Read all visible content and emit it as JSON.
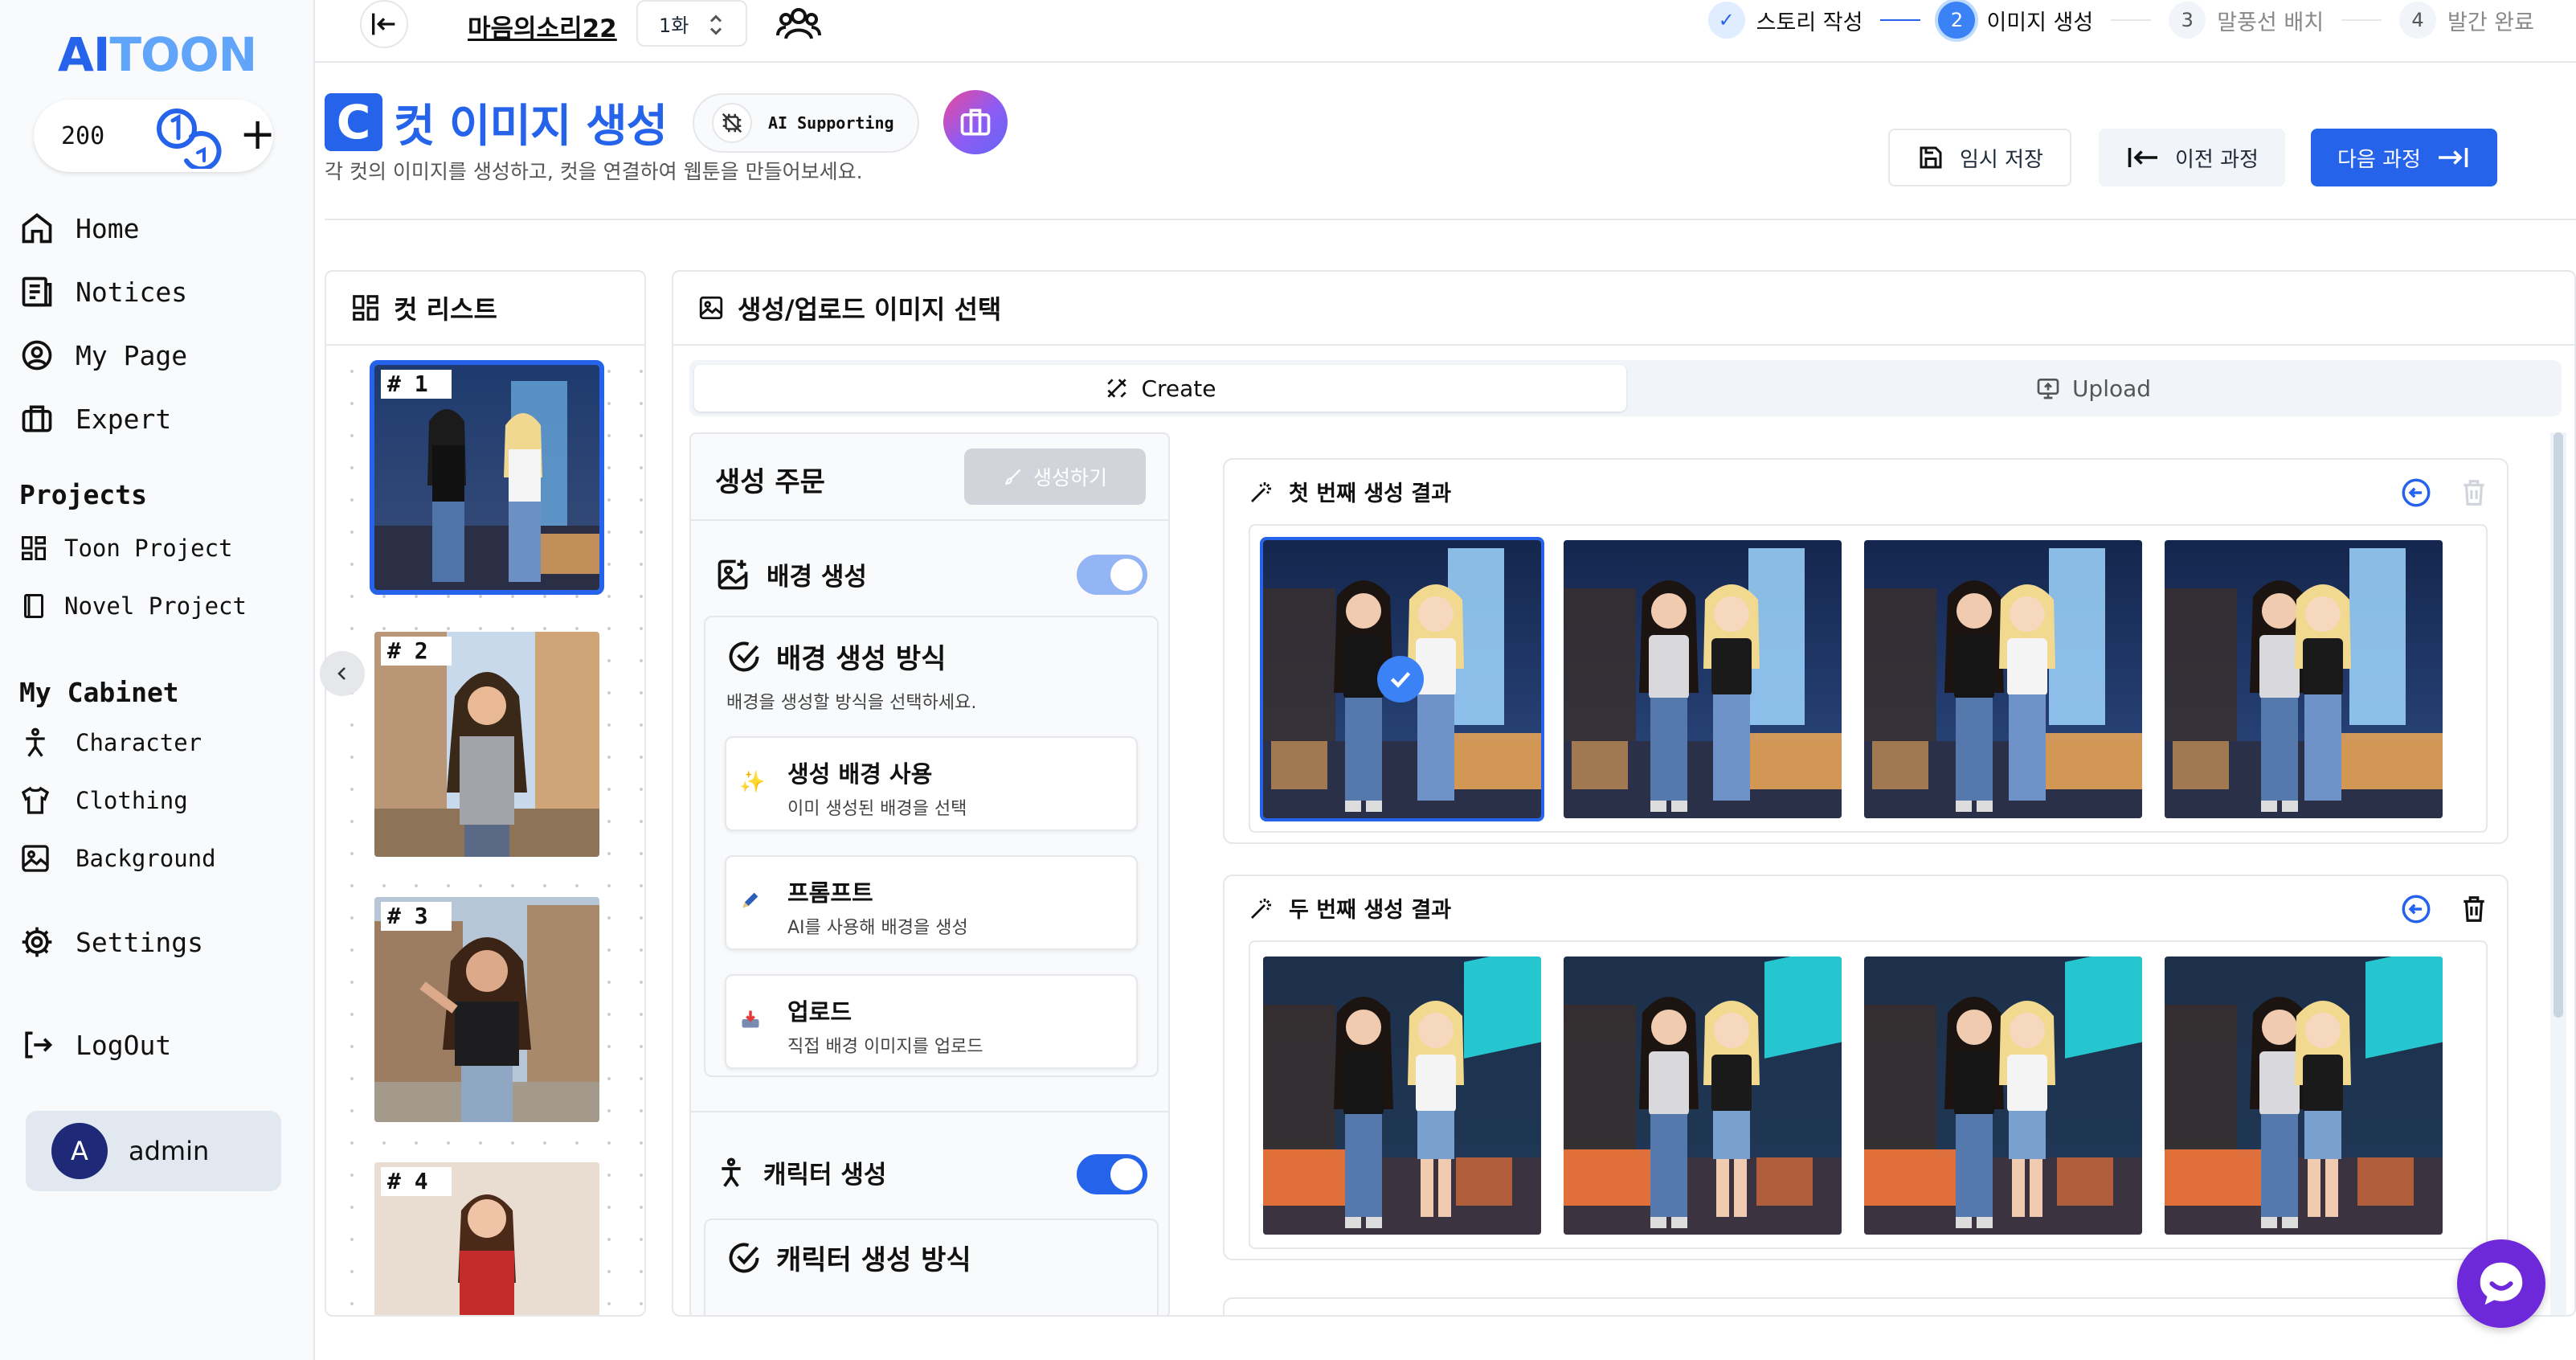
{
  "sidebar": {
    "logo_ai": "AI",
    "logo_toon": "TOON",
    "credits": "200",
    "nav_main": [
      {
        "label": "Home",
        "icon": "home-icon"
      },
      {
        "label": "Notices",
        "icon": "notices-icon"
      },
      {
        "label": "My Page",
        "icon": "user-circle-icon"
      },
      {
        "label": "Expert",
        "icon": "briefcase-icon"
      }
    ],
    "projects_heading": "Projects",
    "projects": [
      {
        "label": "Toon Project",
        "icon": "toon-icon"
      },
      {
        "label": "Novel Project",
        "icon": "book-icon"
      }
    ],
    "cabinet_heading": "My Cabinet",
    "cabinet": [
      {
        "label": "Character",
        "icon": "person-icon"
      },
      {
        "label": "Clothing",
        "icon": "shirt-icon"
      },
      {
        "label": "Background",
        "icon": "image-icon"
      }
    ],
    "settings": "Settings",
    "logout": "LogOut",
    "user": {
      "initial": "A",
      "name": "admin"
    }
  },
  "topbar": {
    "project_title": "마음의소리22",
    "episode": "1화",
    "steps": [
      {
        "label": "스토리 작성",
        "marker": "✓",
        "state": "done"
      },
      {
        "label": "이미지 생성",
        "marker": "2",
        "state": "active"
      },
      {
        "label": "말풍선 배치",
        "marker": "3",
        "state": "todo"
      },
      {
        "label": "발간 완료",
        "marker": "4",
        "state": "todo"
      }
    ]
  },
  "page": {
    "badge": "C",
    "title": "컷 이미지 생성",
    "ai_pill": "AI Supporting",
    "subtitle": "각 컷의 이미지를 생성하고, 컷을 연결하여 웹툰을 만들어보세요.",
    "btn_save": "임시 저장",
    "btn_prev": "이전 과정",
    "btn_next": "다음 과정"
  },
  "cutlist": {
    "title": "컷 리스트",
    "cuts": [
      "# 1",
      "# 2",
      "# 3",
      "# 4"
    ],
    "selected_index": 0
  },
  "main": {
    "title": "생성/업로드 이미지 선택",
    "tabs": [
      {
        "label": "Create",
        "active": true
      },
      {
        "label": "Upload",
        "active": false
      }
    ],
    "order": {
      "title": "생성 주문",
      "generate_btn": "생성하기",
      "bg_section": "배경 생성",
      "bg_toggle_on": true,
      "method_title": "배경 생성 방식",
      "method_sub": "배경을 생성할 방식을 선택하세요.",
      "options": [
        {
          "title": "생성 배경 사용",
          "sub": "이미 생성된 배경을 선택",
          "icon": "sparkle-icon"
        },
        {
          "title": "프롬프트",
          "sub": "AI를 사용해 배경을 생성",
          "icon": "pencil-icon"
        },
        {
          "title": "업로드",
          "sub": "직접 배경 이미지를 업로드",
          "icon": "inbox-icon"
        }
      ],
      "char_section": "캐릭터 생성",
      "char_toggle_on": true,
      "char_method_title": "캐릭터 생성 방식"
    },
    "results": [
      {
        "title": "첫 번째 생성 결과",
        "selected_index": 0,
        "scene": "night-street-blue"
      },
      {
        "title": "두 번째 생성 결과",
        "selected_index": -1,
        "scene": "night-street-neon"
      }
    ]
  },
  "colors": {
    "accent": "#2563eb",
    "accent_light": "#60a5fa",
    "border": "#e5e7eb",
    "toggle_on": "#2563eb",
    "toggle_partial": "#93b4f5"
  }
}
